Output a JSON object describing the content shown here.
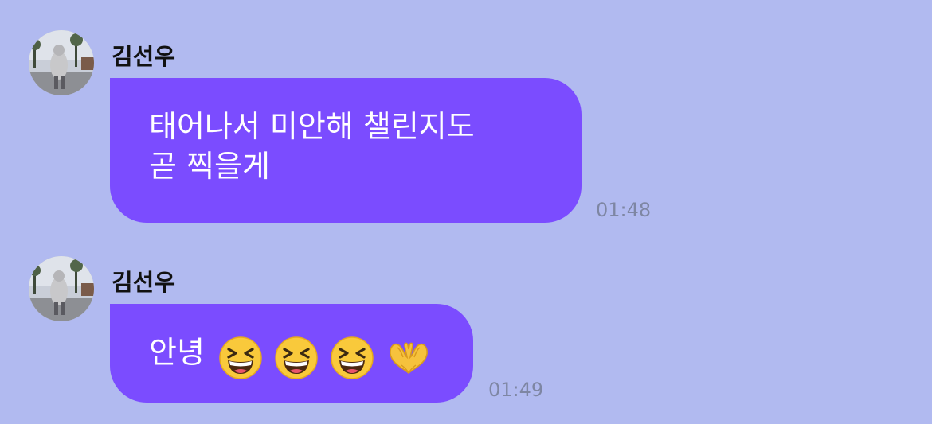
{
  "messages": [
    {
      "sender": "김선우",
      "text": "태어나서 미안해 챌린지도\n곧 찍을게",
      "time": "01:48"
    },
    {
      "sender": "김선우",
      "text": "안녕",
      "emojis": [
        "grinning-squinting-face",
        "grinning-squinting-face",
        "grinning-squinting-face",
        "heart-hands"
      ],
      "time": "01:49"
    }
  ],
  "colors": {
    "background": "#b1baf0",
    "bubble": "#7b4cff",
    "bubble_text": "#ffffff",
    "time_text": "#7e86a3"
  }
}
